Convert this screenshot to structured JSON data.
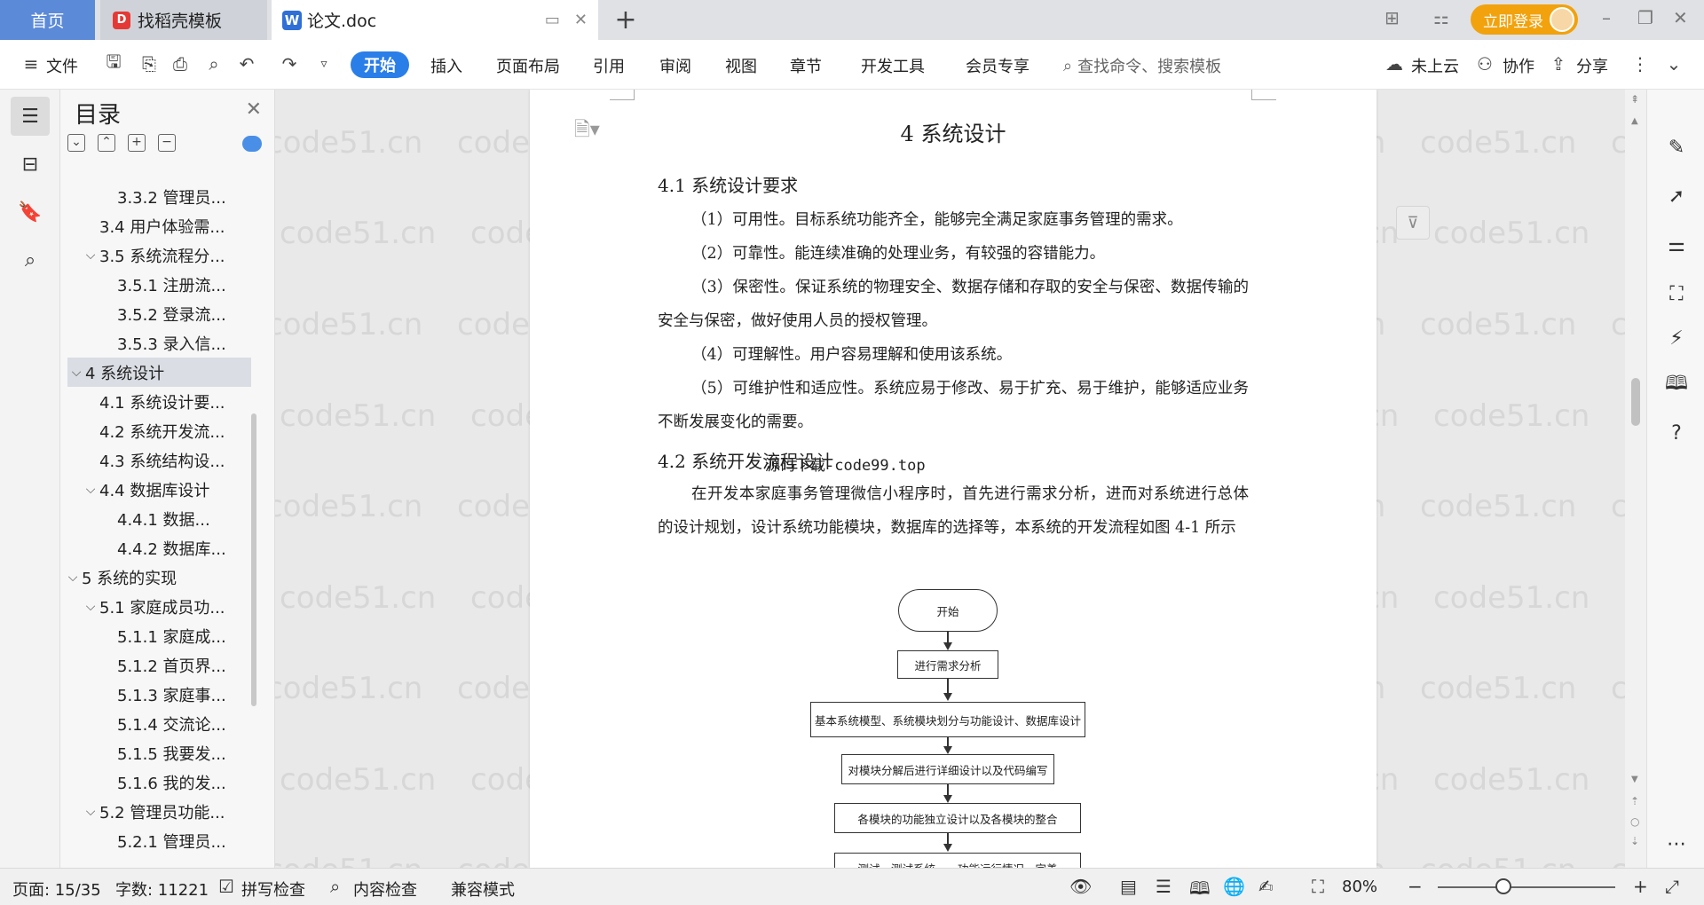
{
  "tabs": {
    "home": "首页",
    "template": "找稻壳模板",
    "doc": "论文.doc",
    "new_tab": "+"
  },
  "titlebar": {
    "login": "立即登录"
  },
  "ribbon": {
    "file": "文件",
    "items": [
      "开始",
      "插入",
      "页面布局",
      "引用",
      "审阅",
      "视图",
      "章节",
      "开发工具",
      "会员专享"
    ],
    "search_placeholder": "查找命令、搜索模板",
    "cloud": "未上云",
    "collab": "协作",
    "share": "分享"
  },
  "toc": {
    "title": "目录",
    "items": [
      {
        "label": "3.3.2 管理员...",
        "level": 3,
        "caret": ""
      },
      {
        "label": "3.4 用户体验需...",
        "level": 2,
        "caret": ""
      },
      {
        "label": "3.5 系统流程分...",
        "level": 2,
        "caret": "v"
      },
      {
        "label": "3.5.1 注册流...",
        "level": 3,
        "caret": ""
      },
      {
        "label": "3.5.2 登录流...",
        "level": 3,
        "caret": ""
      },
      {
        "label": "3.5.3 录入信...",
        "level": 3,
        "caret": ""
      },
      {
        "label": "4 系统设计",
        "level": 1,
        "caret": "v",
        "selected": true
      },
      {
        "label": "4.1 系统设计要...",
        "level": 2,
        "caret": ""
      },
      {
        "label": "4.2 系统开发流...",
        "level": 2,
        "caret": ""
      },
      {
        "label": "4.3 系统结构设...",
        "level": 2,
        "caret": ""
      },
      {
        "label": "4.4 数据库设计",
        "level": 2,
        "caret": "v"
      },
      {
        "label": "4.4.1 数据...",
        "level": 3,
        "caret": ""
      },
      {
        "label": "4.4.2 数据库...",
        "level": 3,
        "caret": ""
      },
      {
        "label": "5  系统的实现",
        "level": 1,
        "caret": "v"
      },
      {
        "label": "5.1 家庭成员功...",
        "level": 2,
        "caret": "v"
      },
      {
        "label": "5.1.1 家庭成...",
        "level": 3,
        "caret": ""
      },
      {
        "label": "5.1.2 首页界...",
        "level": 3,
        "caret": ""
      },
      {
        "label": "5.1.3 家庭事...",
        "level": 3,
        "caret": ""
      },
      {
        "label": "5.1.4 交流论...",
        "level": 3,
        "caret": ""
      },
      {
        "label": "5.1.5 我要发...",
        "level": 3,
        "caret": ""
      },
      {
        "label": "5.1.6 我的发...",
        "level": 3,
        "caret": ""
      },
      {
        "label": "5.2 管理员功能...",
        "level": 2,
        "caret": "v"
      },
      {
        "label": "5.2.1 管理员...",
        "level": 3,
        "caret": ""
      }
    ]
  },
  "document": {
    "chapter_title": "4 系统设计",
    "sec1_title": "4.1 系统设计要求",
    "sec1_paras": [
      "（1）可用性。目标系统功能齐全，能够完全满足家庭事务管理的需求。",
      "（2）可靠性。能连续准确的处理业务，有较强的容错能力。",
      "（3）保密性。保证系统的物理安全、数据存储和存取的安全与保密、数据传输的安全与保密，做好使用人员的授权管理。",
      "（4）可理解性。用户容易理解和使用该系统。",
      "（5）可维护性和适应性。系统应易于修改、易于扩充、易于维护，能够适应业务不断发展变化的需要。"
    ],
    "sec2_title": "4.2 系统开发流程设计",
    "overlay": "源码下载-code99.top",
    "sec2_para": "在开发本家庭事务管理微信小程序时，首先进行需求分析，进而对系统进行总体的设计规划，设计系统功能模块，数据库的选择等，本系统的开发流程如图 4-1 所示",
    "flow": [
      "开始",
      "进行需求分析",
      "基本系统模型、系统模块划分与功能设计、数据库设计",
      "对模块分解后进行详细设计以及代码编写",
      "各模块的功能独立设计以及各模块的整合",
      "测试，测试系统……功能运行情况，完善"
    ]
  },
  "watermark": "code51.cn",
  "status": {
    "page": "页面: 15/35",
    "words": "字数: 11221",
    "spell": "拼写检查",
    "content_check": "内容检查",
    "compat": "兼容模式",
    "zoom": "80%"
  }
}
